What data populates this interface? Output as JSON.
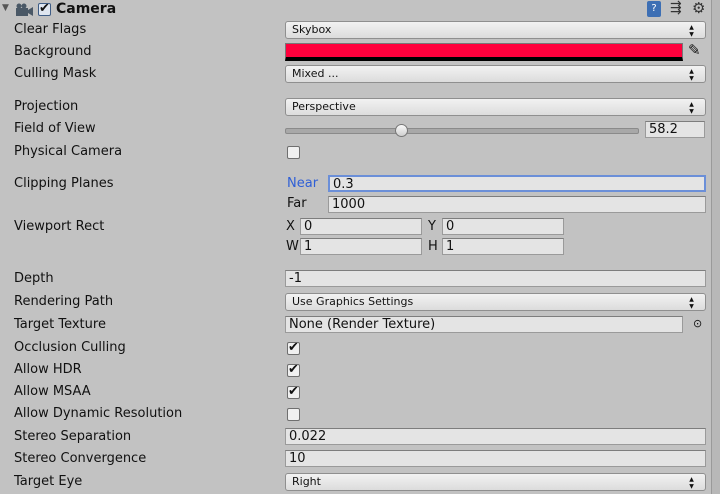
{
  "header": {
    "title": "Camera",
    "enabled": true
  },
  "fields": {
    "clear_flags": {
      "label": "Clear Flags",
      "value": "Skybox"
    },
    "background": {
      "label": "Background",
      "color": "#ff003c"
    },
    "culling_mask": {
      "label": "Culling Mask",
      "value": "Mixed ..."
    },
    "projection": {
      "label": "Projection",
      "value": "Perspective"
    },
    "fov": {
      "label": "Field of View",
      "value": "58.2",
      "fraction": 0.33
    },
    "physical_camera": {
      "label": "Physical Camera",
      "checked": false
    },
    "clipping": {
      "label": "Clipping Planes",
      "near_label": "Near",
      "near": "0.3",
      "far_label": "Far",
      "far": "1000"
    },
    "viewport": {
      "label": "Viewport Rect",
      "x_label": "X",
      "x": "0",
      "y_label": "Y",
      "y": "0",
      "w_label": "W",
      "w": "1",
      "h_label": "H",
      "h": "1"
    },
    "depth": {
      "label": "Depth",
      "value": "-1"
    },
    "rendering_path": {
      "label": "Rendering Path",
      "value": "Use Graphics Settings"
    },
    "target_texture": {
      "label": "Target Texture",
      "value": "None (Render Texture)"
    },
    "occlusion_culling": {
      "label": "Occlusion Culling",
      "checked": true
    },
    "allow_hdr": {
      "label": "Allow HDR",
      "checked": true
    },
    "allow_msaa": {
      "label": "Allow MSAA",
      "checked": true
    },
    "allow_dynamic_resolution": {
      "label": "Allow Dynamic Resolution",
      "checked": false
    },
    "stereo_separation": {
      "label": "Stereo Separation",
      "value": "0.022"
    },
    "stereo_convergence": {
      "label": "Stereo Convergence",
      "value": "10"
    },
    "target_eye": {
      "label": "Target Eye",
      "value": "Right"
    }
  },
  "check_glyph": "✔",
  "arrow_glyph": "▲▼"
}
